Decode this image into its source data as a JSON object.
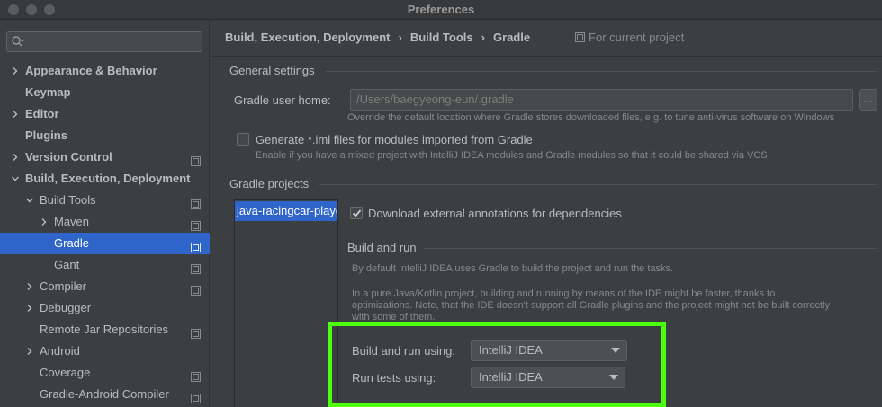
{
  "window": {
    "title": "Preferences"
  },
  "sidebar": {
    "search_placeholder": "",
    "items": [
      {
        "label": "Appearance & Behavior",
        "level": 0,
        "expandable": true,
        "bold": true
      },
      {
        "label": "Keymap",
        "level": 0,
        "expandable": false,
        "bold": true
      },
      {
        "label": "Editor",
        "level": 0,
        "expandable": true,
        "bold": true
      },
      {
        "label": "Plugins",
        "level": 0,
        "expandable": false,
        "bold": true
      },
      {
        "label": "Version Control",
        "level": 0,
        "expandable": true,
        "bold": true,
        "project": true
      },
      {
        "label": "Build, Execution, Deployment",
        "level": 0,
        "expanded": true,
        "bold": true
      },
      {
        "label": "Build Tools",
        "level": 1,
        "expanded": true,
        "project": true
      },
      {
        "label": "Maven",
        "level": 2,
        "expandable": true,
        "project": true
      },
      {
        "label": "Gradle",
        "level": 2,
        "selected": true,
        "project": true
      },
      {
        "label": "Gant",
        "level": 2,
        "project": true
      },
      {
        "label": "Compiler",
        "level": 1,
        "expandable": true,
        "project": true
      },
      {
        "label": "Debugger",
        "level": 1,
        "expandable": true
      },
      {
        "label": "Remote Jar Repositories",
        "level": 1,
        "project": true
      },
      {
        "label": "Android",
        "level": 1,
        "expandable": true
      },
      {
        "label": "Coverage",
        "level": 1,
        "project": true
      },
      {
        "label": "Gradle-Android Compiler",
        "level": 1,
        "project": true
      }
    ]
  },
  "breadcrumb": {
    "items": [
      "Build, Execution, Deployment",
      "Build Tools",
      "Gradle"
    ],
    "separator": "›",
    "current_project_label": "For current project"
  },
  "general": {
    "title": "General settings",
    "gradle_home_label": "Gradle user home:",
    "gradle_home_value": "/Users/baegyeong-eun/.gradle",
    "browse_label": "...",
    "gradle_home_hint": "Override the default location where Gradle stores downloaded files, e.g. to tune anti-virus software on Windows",
    "iml_label": "Generate *.iml files for modules imported from Gradle",
    "iml_checked": false,
    "iml_hint": "Enable if you have a mixed project with IntelliJ IDEA modules and Gradle modules so that it could be shared via VCS"
  },
  "projects": {
    "title": "Gradle projects",
    "list": [
      "java-racingcar-playground"
    ],
    "download_label": "Download external annotations for dependencies",
    "download_checked": true,
    "build_run_title": "Build and run",
    "para1": "By default IntelliJ IDEA uses Gradle to build the project and run the tasks.",
    "para2_line1": "In a pure Java/Kotlin project, building and running by means of the IDE might be faster, thanks to",
    "para2_line2": "optimizations. Note, that the IDE doesn't support all Gradle plugins and the project might not be built correctly",
    "para2_line3": "with some of them.",
    "build_run_using_label": "Build and run using:",
    "build_run_using_value": "IntelliJ IDEA",
    "run_tests_label": "Run tests using:",
    "run_tests_value": "IntelliJ IDEA"
  },
  "colors": {
    "selection": "#2f65ca",
    "highlight": "#4cff0e",
    "background": "#3c3f41"
  }
}
